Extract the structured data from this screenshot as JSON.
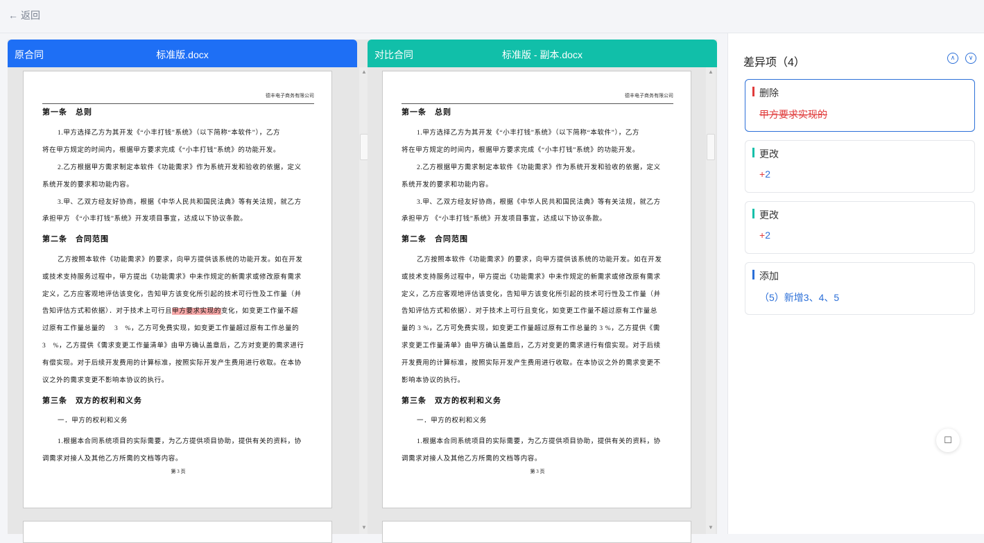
{
  "topbar": {
    "back_label": "返回"
  },
  "left_panel": {
    "title": "原合同",
    "file": "标准版.docx"
  },
  "right_panel": {
    "title": "对比合同",
    "file": "标准版 - 副本.docx"
  },
  "doc": {
    "company": "德丰电子商务有限公司",
    "page_number": "第 3 页",
    "left_lines": [
      "第一条　总则",
      "1.甲方选择乙方为其开发《“小丰打钱”系统》（以下简称“本软件”），乙方",
      "将在甲方规定的时间内，根据甲方要求完成《“小丰打钱”系统》的功能开发。",
      "2.乙方根据甲方需求制定本软件《功能需求》作为系统开发和验收的依据，定义",
      "系统开发的要求和功能内容。",
      "3.甲、乙双方经友好协商，根据《中华人民共和国民法典》等有关法规，就乙方",
      "承担甲方 《“小丰打钱”系统》开发项目事宜，达成以下协议条款。",
      "第二条　合同范围",
      "乙方按照本软件《功能需求》的要求，向甲方提供该系统的功能开发。如在开发",
      "或技术支持服务过程中，甲方提出《功能需求》中未作规定的新需求或修改原有需求",
      "定义，乙方应客观地评估该变化，告知甲方该变化所引起的技术可行性及工作量（并",
      "第三条　双方的权利和义务",
      "一．甲方的权利和义务",
      "1.根据本合同系统项目的实际需要，为乙方提供项目协助，提供有关的资料，协",
      "调需求对接人及其他乙方所需的文档等内容。"
    ],
    "left_hl": {
      "before": "告知评估方式和依据）．对于技术上可行且",
      "mark": "甲方要求实现的",
      "after": "变化，如变更工作量不超"
    },
    "left_extra": [
      "过原有工作量总量的　 3　%，乙方可免费实现，如变更工作量超过原有工作总量的",
      "3　%，乙方提供《需求变更工作量清单》由甲方确认盖章后，乙方对变更的需求进行",
      "有偿实现。对于后续开发费用的计算标准，按照实际开发产生费用进行收取。在本协",
      "议之外的需求变更不影响本协议的执行。"
    ],
    "right_lines": [
      "告知评估方式和依据）．对于技术上可行且变化，如变更工作量不超过原有工作量总",
      "量的 3 %，乙方可免费实现，如变更工作量超过原有工作总量的 3 %，乙方提供《需",
      "求变更工作量清单》由甲方确认盖章后，乙方对变更的需求进行有偿实现。对于后续",
      "开发费用的计算标准，按照实际开发产生费用进行收取。在本协议之外的需求变更不",
      "影响本协议的执行。"
    ]
  },
  "diff": {
    "title": "差异项（4）",
    "items": [
      {
        "type": "删除",
        "content": "甲方要求实现的",
        "color": "#e03b3b"
      },
      {
        "type": "更改",
        "sign": "+",
        "content": "2",
        "color": "#11bfa9"
      },
      {
        "type": "更改",
        "sign": "+",
        "content": "2",
        "color": "#11bfa9"
      },
      {
        "type": "添加",
        "content": "（5）新增3、4、5",
        "color": "#2b6fd8"
      }
    ]
  }
}
